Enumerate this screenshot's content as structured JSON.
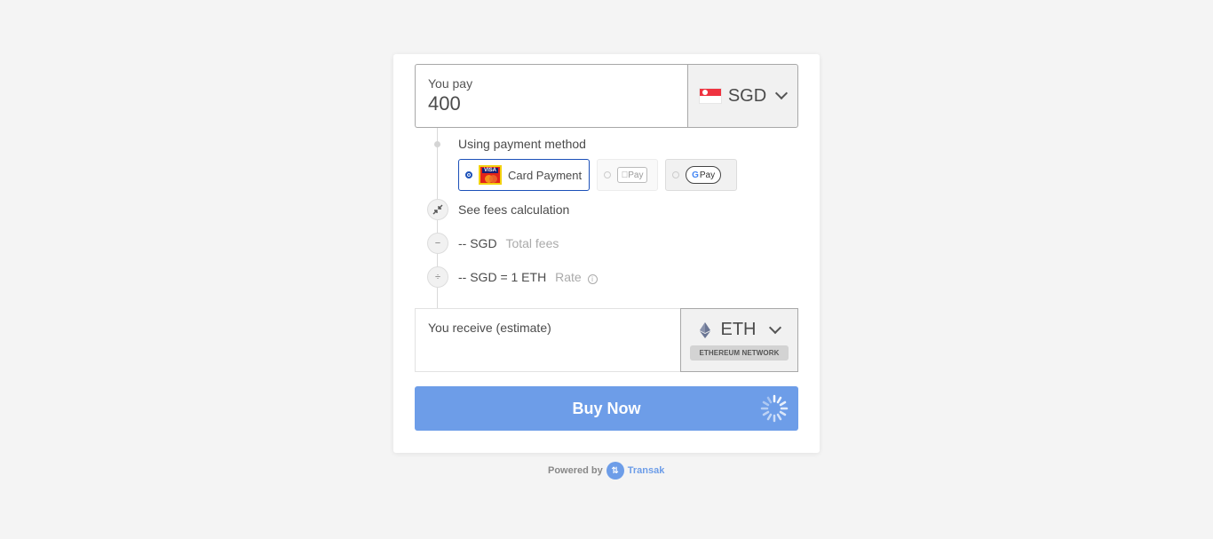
{
  "pay": {
    "label": "You pay",
    "amount": "400",
    "currency": "SGD"
  },
  "payment_method": {
    "label": "Using payment method",
    "options": [
      {
        "label": "Card Payment",
        "selected": true,
        "logo_text": "VISA"
      },
      {
        "label": "Pay",
        "selected": false,
        "brand": "Apple Pay",
        "disabled": true
      },
      {
        "label": "Pay",
        "selected": false,
        "brand": "Google Pay"
      }
    ]
  },
  "fees": {
    "link": "See fees calculation",
    "total_value": "-- SGD",
    "total_label": "Total fees",
    "rate_value": "-- SGD = 1 ETH",
    "rate_label": "Rate",
    "icons": [
      "collapse-icon",
      "minus-icon",
      "divide-icon"
    ]
  },
  "receive": {
    "label": "You receive (estimate)",
    "amount": "",
    "currency": "ETH",
    "network": "ETHEREUM NETWORK"
  },
  "buy_button": {
    "label": "Buy Now"
  },
  "footer": {
    "powered_by": "Powered by",
    "brand": "Transak"
  },
  "colors": {
    "accent": "#6d9de8",
    "selected_border": "#1b50b8",
    "background": "#f4f4f4"
  }
}
